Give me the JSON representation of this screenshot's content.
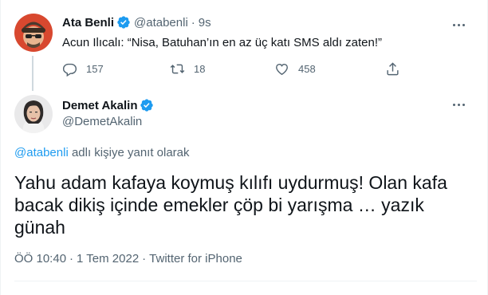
{
  "parent_tweet": {
    "name": "Ata Benli",
    "handle": "@atabenli",
    "separator": "·",
    "time": "9s",
    "text": "Acun Ilıcalı: “Nisa, Batuhan’ın en az üç katı SMS aldı zaten!”",
    "actions": {
      "reply_count": "157",
      "retweet_count": "18",
      "like_count": "458"
    },
    "icons": [
      "verified-badge-icon",
      "more-icon",
      "reply-icon",
      "retweet-icon",
      "like-icon",
      "share-icon"
    ]
  },
  "main_tweet": {
    "name": "Demet Akalin",
    "handle": "@DemetAkalin",
    "reply_to_mention": "@atabenli",
    "reply_to_suffix": " adlı kişiye yanıt olarak",
    "text": "Yahu adam kafaya koymuş kılıfı uydurmuş! Olan kafa bacak dikiş içinde emekler çöp bi yarışma … yazık günah",
    "time": "ÖÖ 10:40",
    "date": "1 Tem 2022",
    "source": "Twitter for iPhone",
    "meta_separator": "·"
  },
  "colors": {
    "accent": "#1d9bf0",
    "text_primary": "#0f1419",
    "text_secondary": "#536471",
    "border": "#eff3f4"
  }
}
